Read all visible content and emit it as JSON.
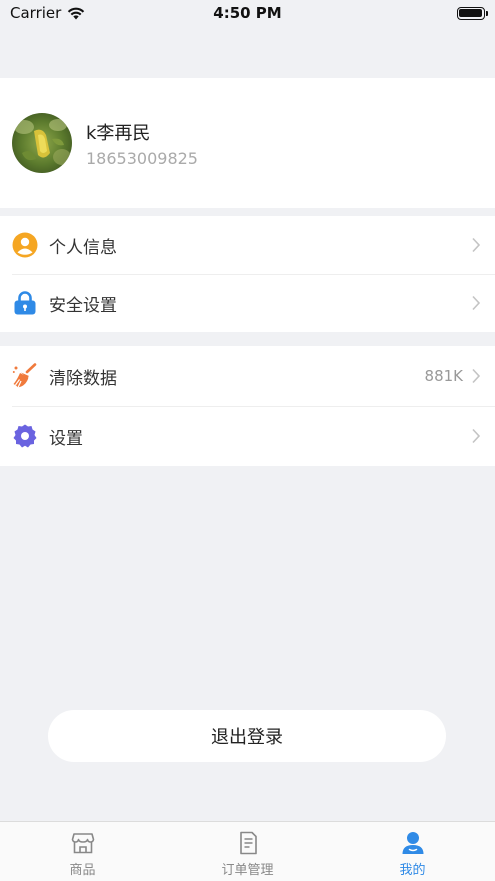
{
  "status_bar": {
    "carrier": "Carrier",
    "time": "4:50 PM"
  },
  "profile": {
    "name": "k李再民",
    "phone": "18653009825"
  },
  "menu": {
    "personal_info": {
      "label": "个人信息",
      "icon": "user-circle-icon",
      "color": "#f5a623"
    },
    "security": {
      "label": "安全设置",
      "icon": "lock-icon",
      "color": "#2f8ae6"
    },
    "clear_data": {
      "label": "清除数据",
      "value": "881K",
      "icon": "broom-icon",
      "color": "#f07a3c"
    },
    "settings": {
      "label": "设置",
      "icon": "gear-icon",
      "color": "#6a63e0"
    }
  },
  "logout": {
    "label": "退出登录"
  },
  "tabbar": {
    "items": [
      {
        "label": "商品",
        "icon": "store-icon",
        "active": false
      },
      {
        "label": "订单管理",
        "icon": "document-icon",
        "active": false
      },
      {
        "label": "我的",
        "icon": "person-icon",
        "active": true
      }
    ],
    "active_color": "#2f8ae6"
  }
}
